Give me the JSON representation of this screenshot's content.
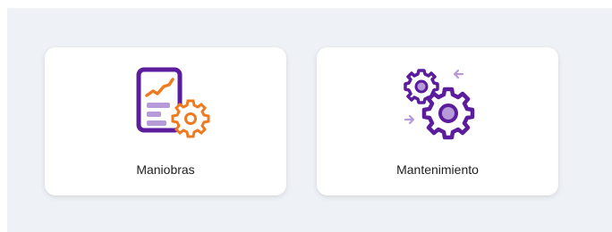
{
  "cards": [
    {
      "label": "Maniobras",
      "icon": "report-gear-icon"
    },
    {
      "label": "Mantenimiento",
      "icon": "gears-icon"
    }
  ],
  "colors": {
    "purple": "#5b1c9d",
    "lavender": "#b79bd9",
    "orange": "#f07a1f",
    "background": "#eef1f5"
  }
}
